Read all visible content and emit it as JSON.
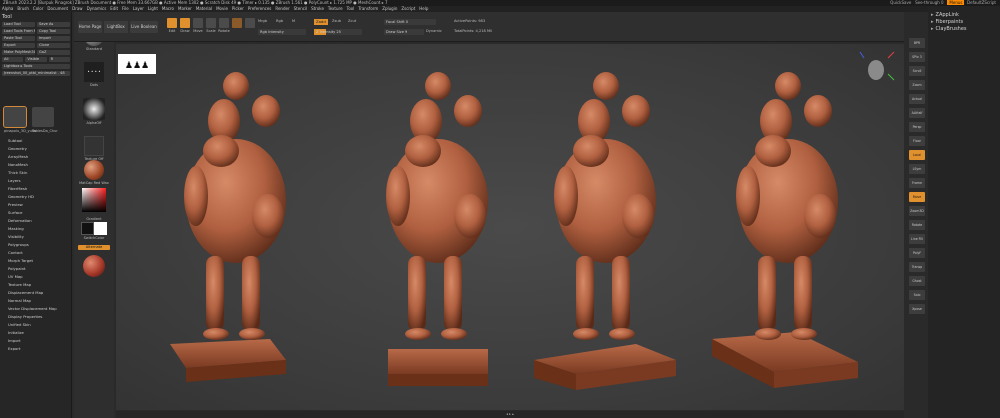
{
  "title": {
    "left": "ZBrush 2023.2.2 [Burpuk Pinagrok]   ZBrush Document   ● Free Mem 33.667GB ● Active Mem 1302 ● Scratch Disk 49 ● Timer ▸ 0.135 ● ZBrush 1.561 ● PolyCount ▸ 1.725 MP ● MeshCount ▸ 7",
    "quicksave": "QuickSave",
    "see_through": "See-through 0",
    "menus": "Menus",
    "default_script": "DefaultZScript"
  },
  "menubar": [
    "Alpha",
    "Brush",
    "Color",
    "Document",
    "Draw",
    "Dynamics",
    "Edit",
    "File",
    "Layer",
    "Light",
    "Macro",
    "Marker",
    "Material",
    "Movie",
    "Picker",
    "Preferences",
    "Render",
    "Stencil",
    "Stroke",
    "Texture",
    "Tool",
    "Transform",
    "Zplugin",
    "Zscript",
    "Help"
  ],
  "left_panel": {
    "title": "Tool",
    "rows": [
      [
        "Load Tool",
        "Save As"
      ],
      [
        "Load Tools From Project",
        "Copy Tool"
      ],
      [
        "Paste Tool",
        "Import"
      ],
      [
        "Export",
        "Clone"
      ],
      [
        "Make PolyMesh3D",
        "GoZ"
      ],
      [
        "All",
        "Visible",
        "R"
      ],
      [
        "Lightbox ▸ Tools"
      ],
      [
        "Jreenshot_00_ptbl_minimalist . 48"
      ]
    ],
    "thumbs": [
      {
        "caption": "pinapolu_3D_yuna",
        "selected": true
      },
      {
        "caption": "TablesDa_Chur",
        "selected": false
      },
      {
        "caption": "minimalist_00_ptbl",
        "selected": false
      }
    ],
    "subpalettes": [
      "Subtool",
      "Geometry",
      "ArrayMesh",
      "NanoMesh",
      "Thick Skin",
      "Layers",
      "FiberMesh",
      "Geometry HD",
      "Preview",
      "Surface",
      "Deformation",
      "Masking",
      "Visibility",
      "Polygroups",
      "Contact",
      "Morph Target",
      "Polypaint",
      "UV Map",
      "Texture Map",
      "Displacement Map",
      "Normal Map",
      "Vector Displacement Map",
      "Display Properties",
      "Unified Skin",
      "Initialize",
      "Import",
      "Export"
    ]
  },
  "tool_strip": {
    "top_buttons": [
      "Home Page",
      "LightBox",
      "Live Boolean"
    ],
    "items": [
      {
        "caption": "Standard"
      },
      {
        "caption": "Dots"
      },
      {
        "caption": "AlphaOff"
      },
      {
        "caption": "Texture Off"
      },
      {
        "caption": "MatCap Red Wax"
      },
      {
        "caption": "Gradient"
      },
      {
        "caption": "SwitchColor"
      },
      {
        "caption": "Alternate"
      }
    ],
    "gradient_label": "Gradient",
    "switch_label": "SwitchColor",
    "alternate_label": "Alternate"
  },
  "topbar": {
    "icons": [
      {
        "label": "Edit",
        "on": true
      },
      {
        "label": "Draw",
        "on": true
      },
      {
        "label": "Move",
        "on": false
      },
      {
        "label": "Scale",
        "on": false
      },
      {
        "label": "Rotate",
        "on": false
      },
      {
        "label": "",
        "on": false
      },
      {
        "label": "",
        "on": false
      }
    ],
    "mrgb": "Mrgb",
    "rgb": "Rgb",
    "m": "M",
    "zadd": "Zadd",
    "zsub": "Zsub",
    "zcut": "Zcut",
    "rgb_intensity": "Rgb Intensity",
    "z_intensity": "Z Intensity 25",
    "focal_shift": "Focal Shift 0",
    "draw_size": "Draw Size 9",
    "dynamic": "Dynamic",
    "active_points": "ActivePoints: 983",
    "total_points": "TotalPoints: 4,218 Mil"
  },
  "canvas": {
    "logo": "♟♟♟"
  },
  "right_strip": [
    "BPR",
    "SPix 3",
    "Scroll",
    "Zoom",
    "Actual",
    "AAHalf",
    "Persp",
    "Floor",
    "Local",
    "LSym",
    "Frame",
    "Move",
    "Zoom3D",
    "Rotate",
    "Line Fill",
    "PolyF",
    "Transp",
    "Ghost",
    "Solo",
    "Xpose"
  ],
  "right_panel": {
    "items": [
      {
        "label": "ZAppLink"
      },
      {
        "label": "Fiberpaints"
      },
      {
        "label": "ClayBrushes"
      }
    ]
  },
  "statusbar": "◂ ▸ ▴"
}
